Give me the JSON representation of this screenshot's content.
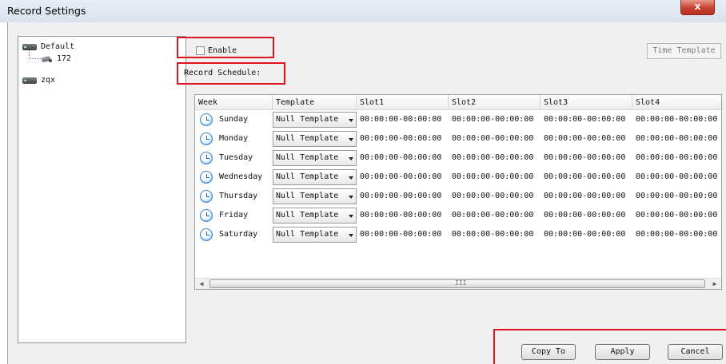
{
  "window": {
    "title": "Record Settings",
    "close_glyph": "x"
  },
  "tree": {
    "nodes": [
      {
        "label": "Default",
        "icon": "dvr-icon"
      },
      {
        "label": "172",
        "icon": "camera-icon"
      },
      {
        "label": "zqx",
        "icon": "dvr-icon"
      }
    ]
  },
  "settings": {
    "enable_label": "Enable",
    "enable_checked": false,
    "time_template_label": "Time Template",
    "record_schedule_label": "Record Schedule:"
  },
  "table": {
    "columns": [
      "Week",
      "Template",
      "Slot1",
      "Slot2",
      "Slot3",
      "Slot4"
    ],
    "rows": [
      {
        "day": "Sunday",
        "template": "Null Template",
        "slots": [
          "00:00:00-00:00:00",
          "00:00:00-00:00:00",
          "00:00:00-00:00:00",
          "00:00:00-00:00:00"
        ]
      },
      {
        "day": "Monday",
        "template": "Null Template",
        "slots": [
          "00:00:00-00:00:00",
          "00:00:00-00:00:00",
          "00:00:00-00:00:00",
          "00:00:00-00:00:00"
        ]
      },
      {
        "day": "Tuesday",
        "template": "Null Template",
        "slots": [
          "00:00:00-00:00:00",
          "00:00:00-00:00:00",
          "00:00:00-00:00:00",
          "00:00:00-00:00:00"
        ]
      },
      {
        "day": "Wednesday",
        "template": "Null Template",
        "slots": [
          "00:00:00-00:00:00",
          "00:00:00-00:00:00",
          "00:00:00-00:00:00",
          "00:00:00-00:00:00"
        ]
      },
      {
        "day": "Thursday",
        "template": "Null Template",
        "slots": [
          "00:00:00-00:00:00",
          "00:00:00-00:00:00",
          "00:00:00-00:00:00",
          "00:00:00-00:00:00"
        ]
      },
      {
        "day": "Friday",
        "template": "Null Template",
        "slots": [
          "00:00:00-00:00:00",
          "00:00:00-00:00:00",
          "00:00:00-00:00:00",
          "00:00:00-00:00:00"
        ]
      },
      {
        "day": "Saturday",
        "template": "Null Template",
        "slots": [
          "00:00:00-00:00:00",
          "00:00:00-00:00:00",
          "00:00:00-00:00:00",
          "00:00:00-00:00:00"
        ]
      }
    ],
    "scroll_grip": "III"
  },
  "buttons": {
    "copy_to": "Copy To",
    "apply": "Apply",
    "cancel": "Cancel"
  },
  "colors": {
    "highlight_box": "#e0141e",
    "close_button": "#c7402f"
  }
}
